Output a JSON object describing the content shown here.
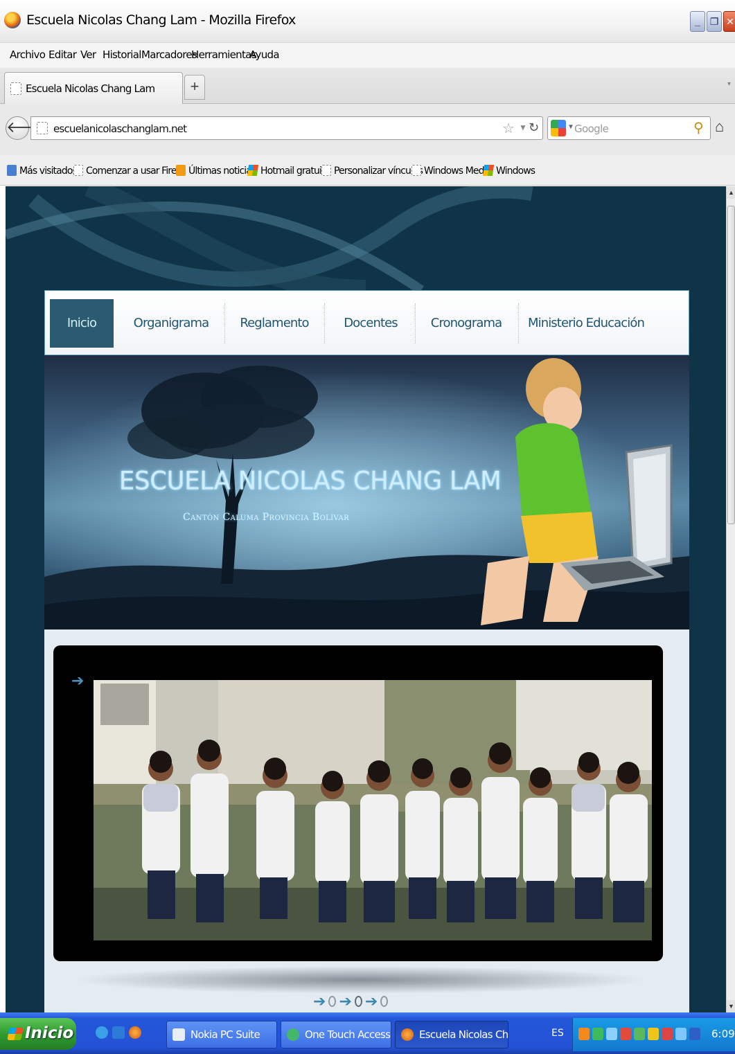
{
  "window": {
    "title": "Escuela Nicolas Chang Lam - Mozilla Firefox",
    "controls": [
      "minimize",
      "maximize",
      "close"
    ]
  },
  "menu": {
    "items": [
      "Archivo",
      "Editar",
      "Ver",
      "Historial",
      "Marcadores",
      "Herramientas",
      "Ayuda"
    ]
  },
  "tabs": {
    "active_label": "Escuela Nicolas Chang Lam",
    "new_tab": "+"
  },
  "navigation": {
    "url": "escuelanicolaschanglam.net",
    "search_placeholder": "Google"
  },
  "bookmarks": {
    "items": [
      {
        "label": "Más visitados",
        "icon": "most-visited-icon"
      },
      {
        "label": "Comenzar a usar Firef...",
        "icon": "page-icon"
      },
      {
        "label": "Últimas noticias",
        "icon": "rss-icon"
      },
      {
        "label": "Hotmail gratuito",
        "icon": "windows-logo-icon"
      },
      {
        "label": "Personalizar vínculos",
        "icon": "page-icon"
      },
      {
        "label": "Windows Media",
        "icon": "page-icon"
      },
      {
        "label": "Windows",
        "icon": "windows-logo-icon"
      }
    ]
  },
  "site": {
    "nav": [
      "Inicio",
      "Organigrama",
      "Reglamento",
      "Docentes",
      "Cronograma",
      "Ministerio Educación"
    ],
    "active_nav": "Inicio",
    "banner_title": "ESCUELA NICOLAS CHANG LAM",
    "banner_subtitle": "Cantón Caluma Provincia Bolívar",
    "slider": {
      "slide_count": 3,
      "current": 2
    }
  },
  "taskbar": {
    "start_label": "Inicio",
    "tasks": [
      {
        "label": "Nokia PC Suite",
        "active": false
      },
      {
        "label": "One Touch Access - ...",
        "active": false
      },
      {
        "label": "Escuela Nicolas Chan...",
        "active": true
      }
    ],
    "language": "ES",
    "clock": "6:09"
  },
  "colors": {
    "page_background": "#0f3448",
    "nav_active": "#2a5b70",
    "nav_text": "#1f5570",
    "taskbar": "#2452d6",
    "start_button": "#2f9b2e"
  }
}
